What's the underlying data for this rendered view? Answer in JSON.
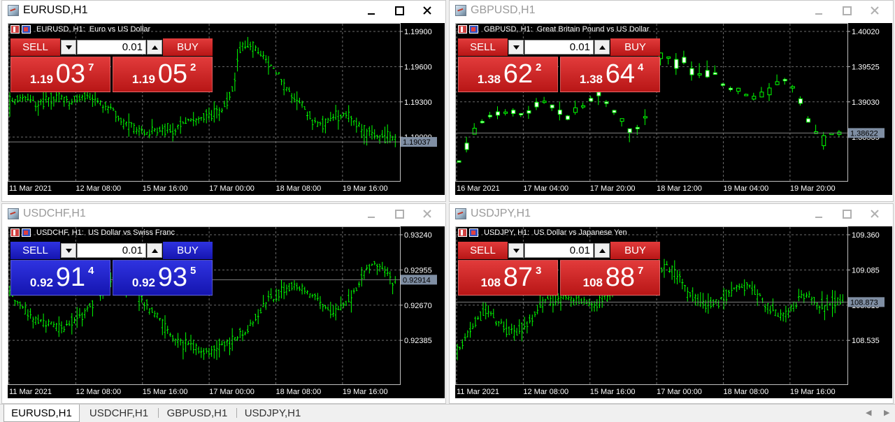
{
  "charts": [
    {
      "title": "EURUSD,H1",
      "description": "EURUSD, H1:  Euro vs US Dollar",
      "active": true,
      "theme": "red",
      "sell_label": "SELL",
      "buy_label": "BUY",
      "lot": "0.01",
      "bid": {
        "prefix": "1.19",
        "big": "03",
        "sup": "7"
      },
      "ask": {
        "prefix": "1.19",
        "big": "05",
        "sup": "2"
      },
      "price_axis": [
        "1.19900",
        "1.19600",
        "1.19300",
        "1.19000"
      ],
      "current_price": "1.19037",
      "time_axis": [
        "11 Mar 2021",
        "12 Mar 08:00",
        "15 Mar 16:00",
        "17 Mar 00:00",
        "18 Mar 08:00",
        "19 Mar 16:00"
      ],
      "style": "bars"
    },
    {
      "title": "GBPUSD,H1",
      "description": "GBPUSD, H1:  Great Britain Pound vs US Dollar",
      "active": false,
      "theme": "red",
      "sell_label": "SELL",
      "buy_label": "BUY",
      "lot": "0.01",
      "bid": {
        "prefix": "1.38",
        "big": "62",
        "sup": "2"
      },
      "ask": {
        "prefix": "1.38",
        "big": "64",
        "sup": "4"
      },
      "price_axis": [
        "1.40020",
        "1.39525",
        "1.39030",
        "1.38535"
      ],
      "current_price": "1.38622",
      "time_axis": [
        "16 Mar 2021",
        "17 Mar 04:00",
        "17 Mar 20:00",
        "18 Mar 12:00",
        "19 Mar 04:00",
        "19 Mar 20:00"
      ],
      "style": "candles"
    },
    {
      "title": "USDCHF,H1",
      "description": "USDCHF, H1:  US Dollar vs Swiss Franc",
      "active": false,
      "theme": "blue",
      "sell_label": "SELL",
      "buy_label": "BUY",
      "lot": "0.01",
      "bid": {
        "prefix": "0.92",
        "big": "91",
        "sup": "4"
      },
      "ask": {
        "prefix": "0.92",
        "big": "93",
        "sup": "5"
      },
      "price_axis": [
        "0.93240",
        "0.92955",
        "0.92670",
        "0.92385"
      ],
      "current_price": "0.92914",
      "time_axis": [
        "11 Mar 2021",
        "12 Mar 08:00",
        "15 Mar 16:00",
        "17 Mar 00:00",
        "18 Mar 08:00",
        "19 Mar 16:00"
      ],
      "style": "bars"
    },
    {
      "title": "USDJPY,H1",
      "description": "USDJPY, H1:  US Dollar vs Japanese Yen",
      "active": false,
      "theme": "red",
      "sell_label": "SELL",
      "buy_label": "BUY",
      "lot": "0.01",
      "bid": {
        "prefix": "108",
        "big": "87",
        "sup": "3"
      },
      "ask": {
        "prefix": "108",
        "big": "88",
        "sup": "7"
      },
      "price_axis": [
        "109.360",
        "109.085",
        "108.810",
        "108.535"
      ],
      "current_price": "108.873",
      "time_axis": [
        "11 Mar 2021",
        "12 Mar 08:00",
        "15 Mar 16:00",
        "17 Mar 00:00",
        "18 Mar 08:00",
        "19 Mar 16:00"
      ],
      "style": "bars"
    }
  ],
  "tabs": [
    "EURUSD,H1",
    "USDCHF,H1",
    "GBPUSD,H1",
    "USDJPY,H1"
  ],
  "active_tab": 0,
  "icons": {
    "app": "chart-app-icon",
    "minimize": "minimize-icon",
    "maximize": "maximize-icon",
    "close": "close-icon"
  },
  "colors": {
    "bars": "#00ff00",
    "candle_up": "#ffffff",
    "sell_red": "#d32323",
    "sell_blue": "#2020d0",
    "grid": "#6b6b6b",
    "price_line": "#808080"
  }
}
